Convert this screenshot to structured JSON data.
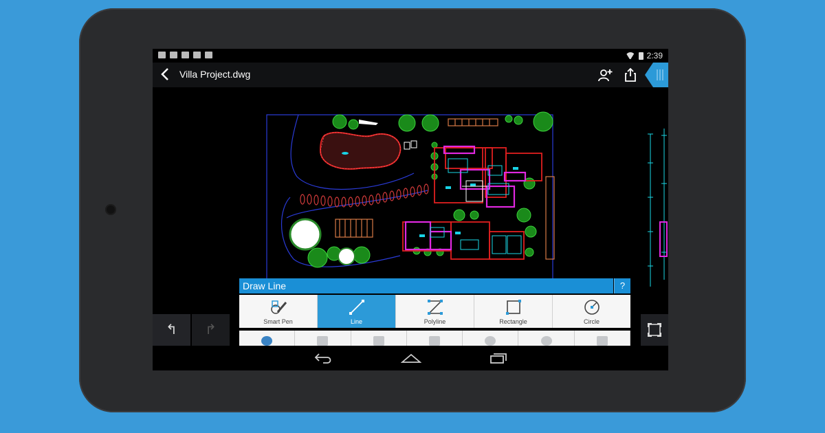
{
  "status": {
    "time": "2:39"
  },
  "appbar": {
    "title": "Villa Project.dwg",
    "icons": [
      "back-arrow-icon",
      "add-user-icon",
      "share-icon",
      "panel-tab-icon"
    ]
  },
  "panel": {
    "title": "Draw Line",
    "help": "?",
    "tools": [
      {
        "label": "Smart Pen",
        "icon": "smart-pen-icon"
      },
      {
        "label": "Line",
        "icon": "line-icon",
        "active": true
      },
      {
        "label": "Polyline",
        "icon": "polyline-icon"
      },
      {
        "label": "Rectangle",
        "icon": "rectangle-icon"
      },
      {
        "label": "Circle",
        "icon": "circle-icon"
      }
    ]
  },
  "colors": {
    "accent": "#1a8fd6",
    "active_tool": "#2c9ad8",
    "background": "#3a9ad9",
    "device": "#2a2b2d"
  },
  "controls": {
    "undo": "↰",
    "redo": "↱"
  }
}
